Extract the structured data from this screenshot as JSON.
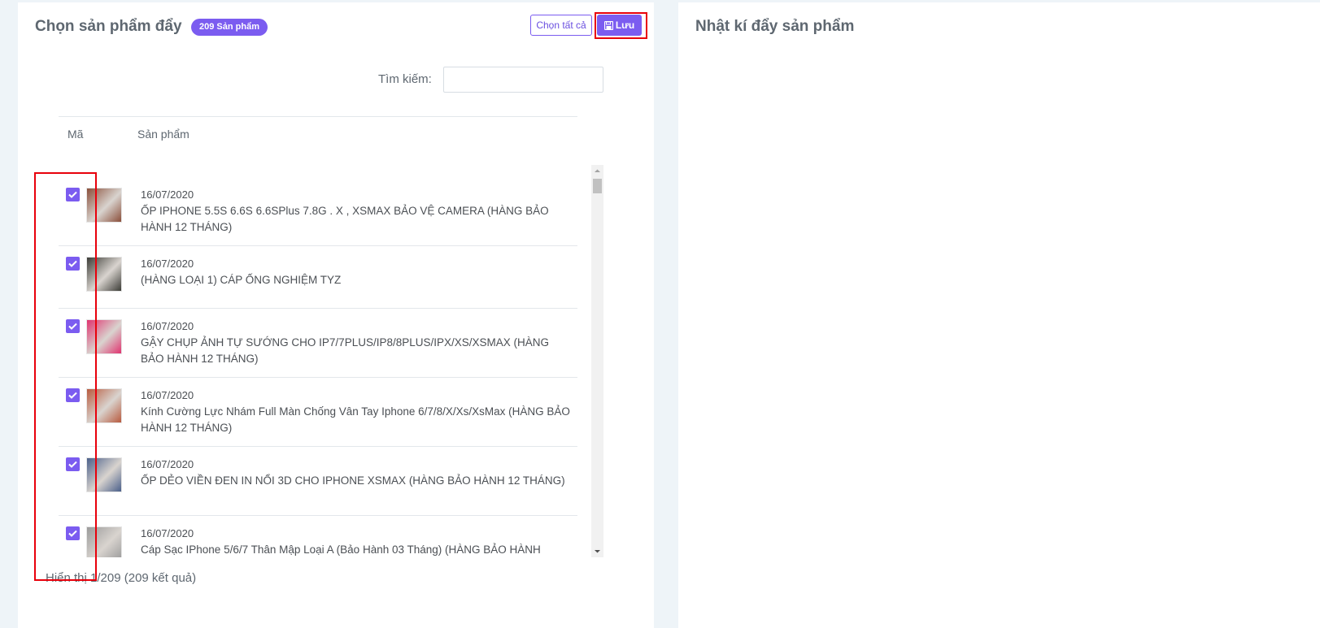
{
  "left_panel": {
    "title": "Chọn sản phẩm đẩy",
    "badge": "209 Sản phẩm",
    "select_all_label": "Chọn tất cả",
    "save_label": "Lưu",
    "search_label": "Tìm kiếm:",
    "search_value": "",
    "columns": [
      "Mã",
      "Sản phẩm"
    ],
    "footer": "Hiển thị 1/209 (209 kết quả)"
  },
  "right_panel": {
    "title": "Nhật kí đẩy sản phẩm"
  },
  "products": [
    {
      "checked": true,
      "date": "16/07/2020",
      "name": "ỐP IPHONE 5.5S 6.6S 6.6SPlus 7.8G . X , XSMAX BẢO VỆ CAMERA (HÀNG BẢO HÀNH 12 THÁNG)",
      "thumb_color": "#8a4e3a"
    },
    {
      "checked": true,
      "date": "16/07/2020",
      "name": "(HÀNG LOẠI 1) CÁP ỐNG NGHIỆM TYZ",
      "thumb_color": "#3b3b36"
    },
    {
      "checked": true,
      "date": "16/07/2020",
      "name": "GẬY CHỤP ẢNH TỰ SƯỚNG CHO IP7/7PLUS/IP8/8PLUS/IPX/XS/XSMAX (HÀNG BẢO HÀNH 12 THÁNG)",
      "thumb_color": "#e0336f"
    },
    {
      "checked": true,
      "date": "16/07/2020",
      "name": "Kính Cường Lực Nhám Full Màn Chống Vân Tay Iphone 6/7/8/X/Xs/XsMax (HÀNG BẢO HÀNH 12 THÁNG)",
      "thumb_color": "#b85a3e"
    },
    {
      "checked": true,
      "date": "16/07/2020",
      "name": "ỐP DẺO VIỀN ĐEN IN NỔI 3D CHO IPHONE XSMAX (HÀNG BẢO HÀNH 12 THÁNG)",
      "thumb_color": "#4a5f8a"
    },
    {
      "checked": true,
      "date": "16/07/2020",
      "name": "Cáp Sạc IPhone 5/6/7 Thân Mập Loại A (Bảo Hành 03 Tháng) (HÀNG BẢO HÀNH",
      "thumb_color": "#9a9a9a"
    }
  ]
}
